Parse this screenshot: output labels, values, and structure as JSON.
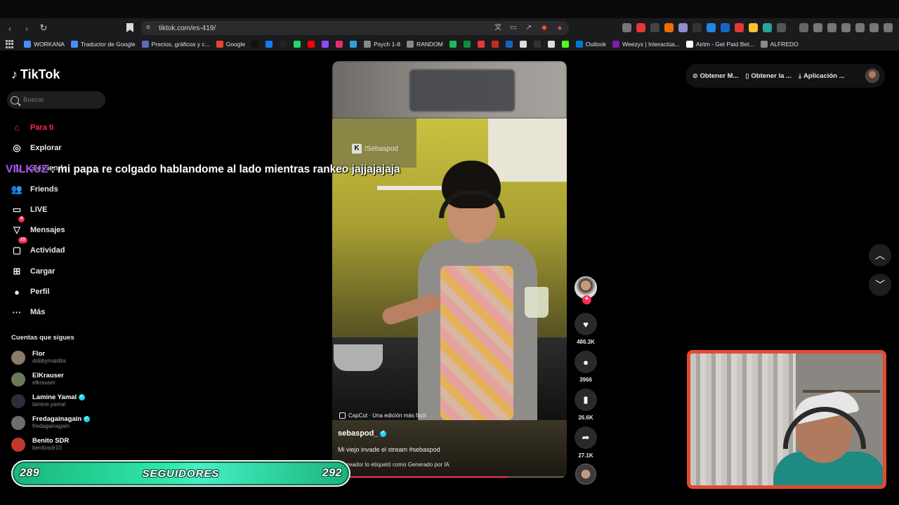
{
  "browser": {
    "url": "tiktok.com/es-419/",
    "bookmarks": [
      {
        "label": "WORKANA",
        "color": "#4a8df6"
      },
      {
        "label": "Traductor de Google",
        "color": "#4a8df6"
      },
      {
        "label": "Precios, gráficos y c...",
        "color": "#5c6bc0"
      },
      {
        "label": "Google",
        "color": "#ea4335"
      },
      {
        "label": "",
        "color": "#111111"
      },
      {
        "label": "",
        "color": "#1877f2"
      },
      {
        "label": "",
        "color": "#222222"
      },
      {
        "label": "",
        "color": "#25d366"
      },
      {
        "label": "",
        "color": "#ff0000"
      },
      {
        "label": "",
        "color": "#9146ff"
      },
      {
        "label": "",
        "color": "#e1306c"
      },
      {
        "label": "",
        "color": "#2b9fe0"
      },
      {
        "label": "Psych 1-8",
        "color": "#888888"
      },
      {
        "label": "RANDOM",
        "color": "#888888"
      },
      {
        "label": "",
        "color": "#1db954"
      },
      {
        "label": "",
        "color": "#0b8f3a"
      },
      {
        "label": "",
        "color": "#e53935"
      },
      {
        "label": "",
        "color": "#c62828"
      },
      {
        "label": "",
        "color": "#1565c0"
      },
      {
        "label": "",
        "color": "#dddddd"
      },
      {
        "label": "",
        "color": "#333333"
      },
      {
        "label": "",
        "color": "#dddddd"
      },
      {
        "label": "",
        "color": "#53fc18"
      },
      {
        "label": "Outlook",
        "color": "#0078d4"
      },
      {
        "label": "Weezyx | Interactúa...",
        "color": "#7b1fa2"
      },
      {
        "label": "Airtm - Get Paid Bet...",
        "color": "#ffffff"
      },
      {
        "label": "ALFREDO",
        "color": "#888888"
      }
    ]
  },
  "tiktok": {
    "logo": "TikTok",
    "search_placeholder": "Buscar",
    "nav": [
      {
        "label": "Para ti",
        "icon": "home-icon",
        "glyph": "⌂",
        "active": true,
        "badge": ""
      },
      {
        "label": "Explorar",
        "icon": "compass-icon",
        "glyph": "◎",
        "active": false,
        "badge": ""
      },
      {
        "label": "Siguiendo",
        "icon": "following-icon",
        "glyph": "♙",
        "active": false,
        "badge": ""
      },
      {
        "label": "Friends",
        "icon": "friends-icon",
        "glyph": "👥",
        "active": false,
        "badge": ""
      },
      {
        "label": "LIVE",
        "icon": "live-icon",
        "glyph": "▭",
        "active": false,
        "badge": ""
      },
      {
        "label": "Mensajes",
        "icon": "messages-icon",
        "glyph": "▽",
        "active": false,
        "badge": "4"
      },
      {
        "label": "Actividad",
        "icon": "activity-icon",
        "glyph": "▢",
        "active": false,
        "badge": "13"
      },
      {
        "label": "Cargar",
        "icon": "upload-icon",
        "glyph": "⊞",
        "active": false,
        "badge": ""
      },
      {
        "label": "Perfil",
        "icon": "profile-icon",
        "glyph": "●",
        "active": false,
        "badge": ""
      },
      {
        "label": "Más",
        "icon": "more-icon",
        "glyph": "···",
        "active": false,
        "badge": ""
      }
    ],
    "following_title": "Cuentas que sigues",
    "following": [
      {
        "name": "Flor",
        "user": "dobbymaldita",
        "verified": false,
        "color": "#8c7b6a"
      },
      {
        "name": "ElKrauser",
        "user": "elkrauser",
        "verified": false,
        "color": "#6a7a5a"
      },
      {
        "name": "Lamine Yamal",
        "user": "lamine.yamal",
        "verified": true,
        "color": "#2e2e3a"
      },
      {
        "name": "Fredagainagain",
        "user": "fredagainagain",
        "verified": true,
        "color": "#6e6e6e"
      },
      {
        "name": "Benito SDR",
        "user": "benitosdr10",
        "verified": false,
        "color": "#c0392b"
      }
    ],
    "top_right": [
      {
        "label": "Obtener M...",
        "icon": "coin-icon",
        "glyph": "⊘"
      },
      {
        "label": "Obtener la ...",
        "icon": "phone-icon",
        "glyph": "▯"
      },
      {
        "label": "Aplicación ...",
        "icon": "download-icon",
        "glyph": "⤓"
      }
    ],
    "video": {
      "watermark": "/Sebaspod",
      "capcut": "CapCut · Una edición más fácil",
      "author": "sebaspod_",
      "description": "Mi viejo invade el stream #sebaspod",
      "ai_label": "El creador lo etiquetó como Generado por IA",
      "progress": 0.74
    },
    "actions": {
      "likes": "486.3K",
      "comments": "3966",
      "saves": "26.6K",
      "shares": "27.1K"
    }
  },
  "stream": {
    "chat_user": "VIILKUZ",
    "chat_message": ": mi papa re colgado hablandome al lado mientras rankeo jajjajajaja",
    "goal_current": "289",
    "goal_label": "SEGUIDORES",
    "goal_target": "292"
  }
}
